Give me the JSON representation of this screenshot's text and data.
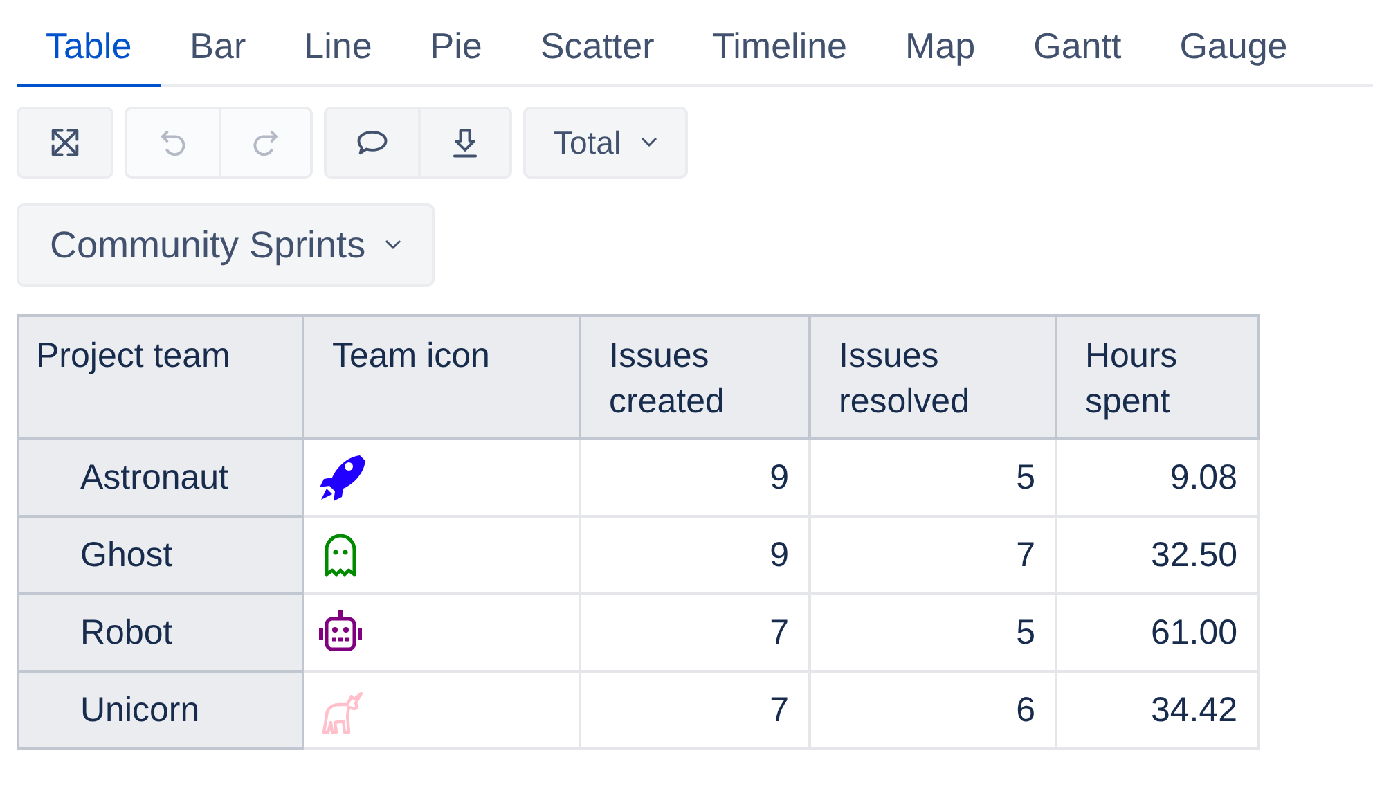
{
  "tabs": [
    {
      "label": "Table",
      "selected": true
    },
    {
      "label": "Bar",
      "selected": false
    },
    {
      "label": "Line",
      "selected": false
    },
    {
      "label": "Pie",
      "selected": false
    },
    {
      "label": "Scatter",
      "selected": false
    },
    {
      "label": "Timeline",
      "selected": false
    },
    {
      "label": "Map",
      "selected": false
    },
    {
      "label": "Gantt",
      "selected": false
    },
    {
      "label": "Gauge",
      "selected": false
    }
  ],
  "toolbar": {
    "groups": [
      [
        {
          "kind": "fullscreen",
          "disabled": false
        }
      ],
      [
        {
          "kind": "undo",
          "disabled": true
        },
        {
          "kind": "redo",
          "disabled": true
        }
      ],
      [
        {
          "kind": "comment",
          "disabled": false
        },
        {
          "kind": "download",
          "disabled": false
        }
      ]
    ],
    "total_dropdown": "Total"
  },
  "page_dropdown": "Community Sprints",
  "table": {
    "columns": [
      "Project team",
      "Team icon",
      "Issues created",
      "Issues resolved",
      "Hours spent"
    ],
    "rows": [
      {
        "team": "Astronaut",
        "kind": "rocket",
        "color": "#2100ff",
        "created": "9",
        "resolved": "5",
        "hours": "9.08"
      },
      {
        "team": "Ghost",
        "kind": "ghost",
        "color": "#008a00",
        "created": "9",
        "resolved": "7",
        "hours": "32.50"
      },
      {
        "team": "Robot",
        "kind": "robot",
        "color": "#800080",
        "created": "7",
        "resolved": "5",
        "hours": "61.00"
      },
      {
        "team": "Unicorn",
        "kind": "unicorn",
        "color": "#ffc0cb",
        "created": "7",
        "resolved": "6",
        "hours": "34.42"
      }
    ]
  }
}
